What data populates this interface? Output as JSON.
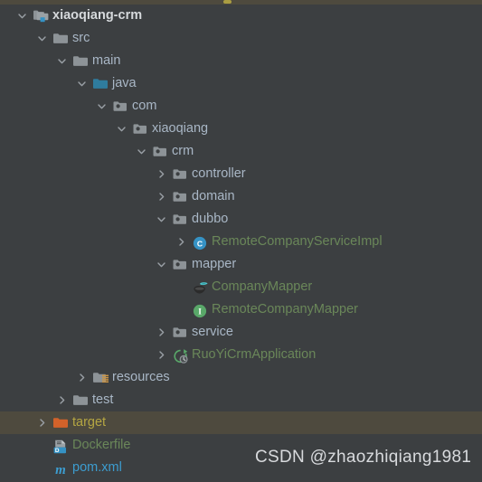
{
  "theme": {
    "background": "#3c3f41",
    "selection_background": "#4e4a3e",
    "default_text": "#a9b7c6",
    "source_text": "#6a8759",
    "excluded_text": "#b5a642",
    "xml_text": "#3c9dd0",
    "arrow": "#9aa0a6"
  },
  "watermark": {
    "text": "CSDN @zhaozhiqiang1981"
  },
  "tree": {
    "name": "project-tree",
    "nodes": [
      {
        "id": "xiaoqiang-crm",
        "label": "xiaoqiang-crm",
        "depth": 0,
        "arrow": "expanded",
        "icon": "module-folder-icon",
        "style": "bold",
        "selected": false
      },
      {
        "id": "src",
        "label": "src",
        "depth": 1,
        "arrow": "expanded",
        "icon": "folder-icon",
        "style": "default",
        "selected": false
      },
      {
        "id": "main",
        "label": "main",
        "depth": 2,
        "arrow": "expanded",
        "icon": "folder-icon",
        "style": "default",
        "selected": false
      },
      {
        "id": "java",
        "label": "java",
        "depth": 3,
        "arrow": "expanded",
        "icon": "source-root-folder-icon",
        "style": "default",
        "selected": false
      },
      {
        "id": "com",
        "label": "com",
        "depth": 4,
        "arrow": "expanded",
        "icon": "package-icon",
        "style": "default",
        "selected": false
      },
      {
        "id": "xiaoqiang",
        "label": "xiaoqiang",
        "depth": 5,
        "arrow": "expanded",
        "icon": "package-icon",
        "style": "default",
        "selected": false
      },
      {
        "id": "crm",
        "label": "crm",
        "depth": 6,
        "arrow": "expanded",
        "icon": "package-icon",
        "style": "default",
        "selected": false
      },
      {
        "id": "controller",
        "label": "controller",
        "depth": 7,
        "arrow": "collapsed",
        "icon": "package-icon",
        "style": "default",
        "selected": false
      },
      {
        "id": "domain",
        "label": "domain",
        "depth": 7,
        "arrow": "collapsed",
        "icon": "package-icon",
        "style": "default",
        "selected": false
      },
      {
        "id": "dubbo",
        "label": "dubbo",
        "depth": 7,
        "arrow": "expanded",
        "icon": "package-icon",
        "style": "default",
        "selected": false
      },
      {
        "id": "RemoteCompanyServiceImpl",
        "label": "RemoteCompanyServiceImpl",
        "depth": 8,
        "arrow": "collapsed",
        "icon": "java-class-icon",
        "style": "green",
        "selected": false
      },
      {
        "id": "mapper",
        "label": "mapper",
        "depth": 7,
        "arrow": "expanded",
        "icon": "package-icon",
        "style": "default",
        "selected": false
      },
      {
        "id": "CompanyMapper",
        "label": "CompanyMapper",
        "depth": 8,
        "arrow": "none",
        "icon": "mybatis-mapper-icon",
        "style": "green",
        "selected": false
      },
      {
        "id": "RemoteCompanyMapper",
        "label": "RemoteCompanyMapper",
        "depth": 8,
        "arrow": "none",
        "icon": "java-interface-icon",
        "style": "green",
        "selected": false
      },
      {
        "id": "service",
        "label": "service",
        "depth": 7,
        "arrow": "collapsed",
        "icon": "package-icon",
        "style": "default",
        "selected": false
      },
      {
        "id": "RuoYiCrmApplication",
        "label": "RuoYiCrmApplication",
        "depth": 7,
        "arrow": "collapsed",
        "icon": "spring-boot-app-icon",
        "style": "green",
        "selected": false
      },
      {
        "id": "resources",
        "label": "resources",
        "depth": 3,
        "arrow": "collapsed",
        "icon": "resource-root-folder-icon",
        "style": "default",
        "selected": false
      },
      {
        "id": "test",
        "label": "test",
        "depth": 2,
        "arrow": "collapsed",
        "icon": "folder-icon",
        "style": "default",
        "selected": false
      },
      {
        "id": "target",
        "label": "target",
        "depth": 1,
        "arrow": "collapsed",
        "icon": "excluded-folder-icon",
        "style": "olive",
        "selected": true
      },
      {
        "id": "Dockerfile",
        "label": "Dockerfile",
        "depth": 1,
        "arrow": "none",
        "icon": "dockerfile-icon",
        "style": "green",
        "selected": false
      },
      {
        "id": "pom.xml",
        "label": "pom.xml",
        "depth": 1,
        "arrow": "none",
        "icon": "maven-pom-icon",
        "style": "teal",
        "selected": false
      }
    ]
  }
}
